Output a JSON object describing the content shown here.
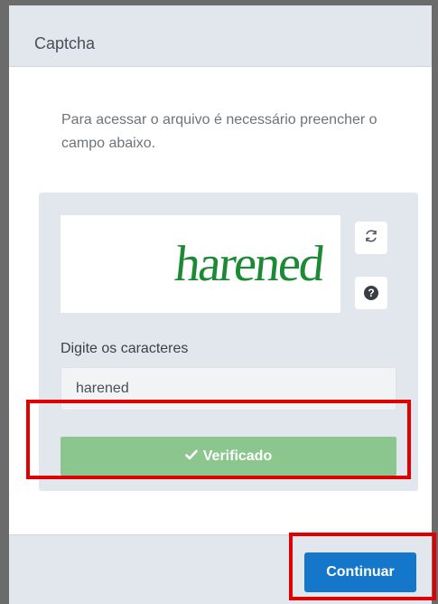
{
  "modal": {
    "title": "Captcha",
    "intro": "Para acessar o arquivo é necessário preencher o campo abaixo."
  },
  "captcha": {
    "image_text": "harened",
    "refresh_icon": "refresh-icon",
    "help_icon": "question-circle-icon",
    "input_label": "Digite os caracteres",
    "input_value": "harened",
    "verified_label": "Verificado",
    "check_icon": "check-icon"
  },
  "footer": {
    "continue_label": "Continuar"
  },
  "colors": {
    "panel_bg": "#e2e7ee",
    "captcha_text": "#1c8a35",
    "verified_bg": "#8ac68e",
    "continue_bg": "#1477c9",
    "highlight": "#e00000"
  }
}
